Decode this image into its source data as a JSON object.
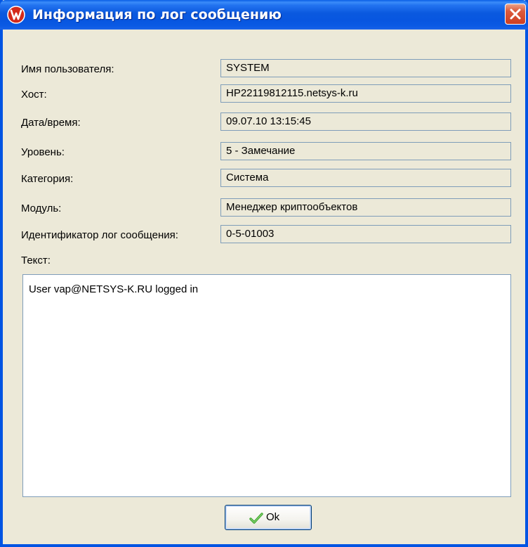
{
  "window": {
    "title": "Информация по лог сообщению",
    "icons": {
      "app": "app-logo-icon",
      "close": "close-icon"
    }
  },
  "fields": [
    {
      "label": "Имя пользователя:",
      "value": "SYSTEM"
    },
    {
      "label": "Хост:",
      "value": "HP22119812115.netsys-k.ru"
    },
    {
      "label": "Дата/время:",
      "value": "09.07.10 13:15:45"
    },
    {
      "label": "Уровень:",
      "value": "5 - Замечание"
    },
    {
      "label": "Категория:",
      "value": "Система"
    },
    {
      "label": "Модуль:",
      "value": "Менеджер криптообъектов"
    },
    {
      "label": "Идентификатор лог сообщения:",
      "value": "0-5-01003"
    }
  ],
  "text_section": {
    "label": "Текст:",
    "content": "User vap@NETSYS-K.RU logged in"
  },
  "buttons": {
    "ok_label": "Ok",
    "ok_icon": "checkmark-icon"
  },
  "colors": {
    "title_bar": "#0a59df",
    "window_bg": "#ece9d8",
    "field_border": "#7f9db9",
    "close_button": "#cd3f22",
    "checkmark": "#3aa62a"
  }
}
